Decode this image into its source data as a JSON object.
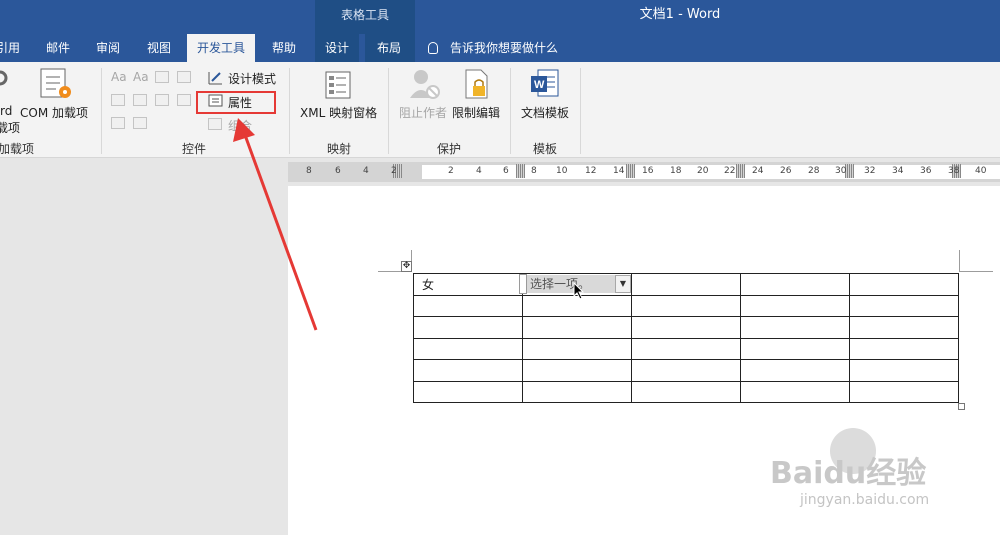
{
  "title_bar": {
    "context_label": "表格工具",
    "document_title": "文档1  -  Word"
  },
  "tabs": [
    {
      "label": "引用"
    },
    {
      "label": "邮件"
    },
    {
      "label": "审阅"
    },
    {
      "label": "视图"
    },
    {
      "label": "开发工具",
      "active": true
    },
    {
      "label": "帮助"
    },
    {
      "label": "设计"
    },
    {
      "label": "布局"
    }
  ],
  "tell_me": "告诉我你想要做什么",
  "ribbon": {
    "addins": {
      "word_addins_line1": "rd",
      "word_addins_line2": "载项",
      "com_addins_label": "COM 加载项",
      "group": "加载项"
    },
    "controls": {
      "design_mode": "设计模式",
      "properties": "属性",
      "group_btn": "组合",
      "group": "控件"
    },
    "mapping": {
      "xml_pane": "XML 映射窗格",
      "group": "映射"
    },
    "protect": {
      "block_authors": "阻止作者",
      "restrict_editing": "限制编辑",
      "group": "保护"
    },
    "templates": {
      "doc_template": "文档模板",
      "group": "模板"
    }
  },
  "ruler": {
    "numbers": [
      "8",
      "6",
      "4",
      "2",
      "2",
      "4",
      "6",
      "8",
      "10",
      "12",
      "14",
      "16",
      "18",
      "20",
      "22",
      "24",
      "26",
      "28",
      "30",
      "32",
      "34",
      "36",
      "38",
      "40"
    ]
  },
  "table": {
    "cell_1_1": "女",
    "dropdown_placeholder": "选择一项。"
  },
  "watermark": {
    "brand": "Baidu经验",
    "url": "jingyan.baidu.com"
  },
  "colors": {
    "accent": "#2b579a",
    "highlight": "#e53935"
  }
}
